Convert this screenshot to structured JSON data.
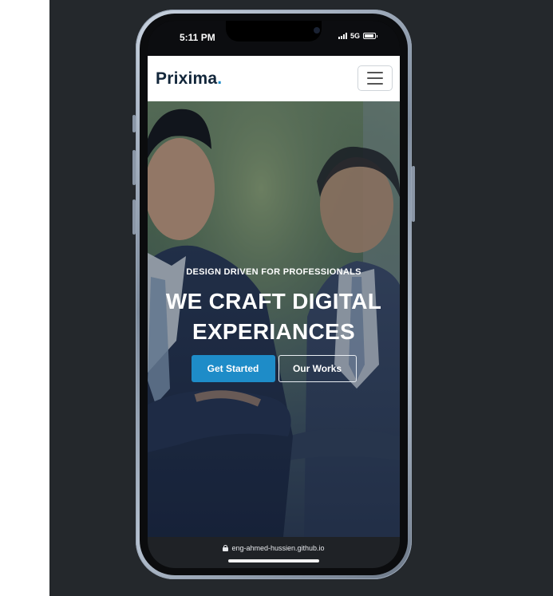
{
  "status_bar": {
    "time": "5:11 PM",
    "network": "5G",
    "battery_level": 0.9
  },
  "navbar": {
    "logo_text": "Prixima",
    "logo_dot": ".",
    "menu_icon": "hamburger-menu-icon"
  },
  "hero": {
    "subtitle": "DESIGN DRIVEN FOR PROFESSIONALS",
    "headline_line1": "WE CRAFT DIGITAL",
    "headline_line2": "EXPERIANCES",
    "primary_button": "Get Started",
    "secondary_button": "Our Works"
  },
  "browser": {
    "url": "eng-ahmed-hussien.github.io",
    "lock_icon": "lock-icon"
  },
  "colors": {
    "brand": "#12263a",
    "accent": "#1e8cc8",
    "backdrop": "#24282c"
  }
}
